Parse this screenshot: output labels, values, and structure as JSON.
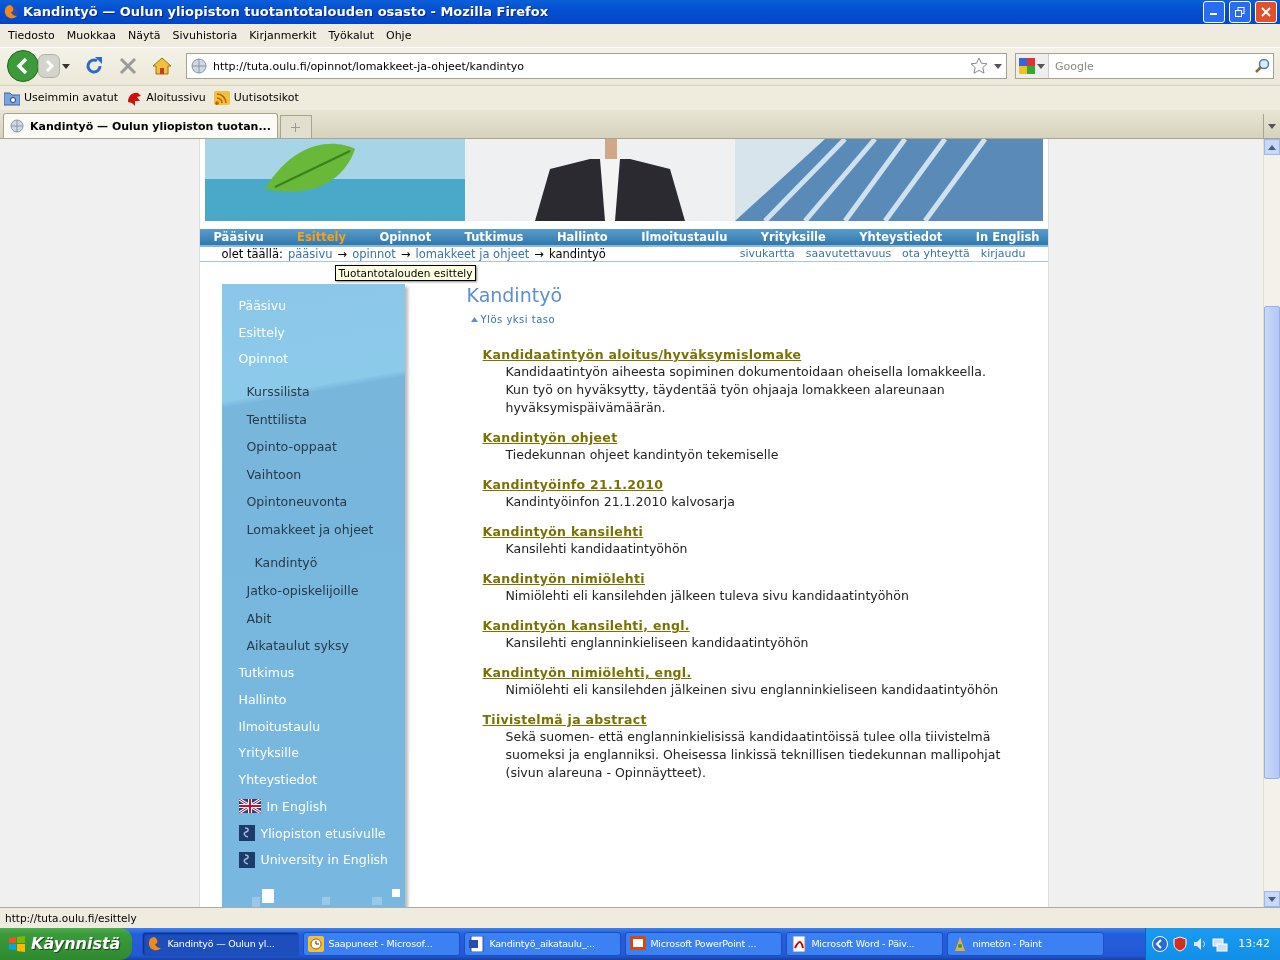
{
  "window": {
    "title": "Kandintyö — Oulun yliopiston tuotantotalouden osasto - Mozilla Firefox"
  },
  "menu": [
    "Tiedosto",
    "Muokkaa",
    "Näytä",
    "Sivuhistoria",
    "Kirjanmerkit",
    "Työkalut",
    "Ohje"
  ],
  "toolbar": {
    "url": "http://tuta.oulu.fi/opinnot/lomakkeet-ja-ohjeet/kandintyo",
    "search": {
      "placeholder": "Google"
    }
  },
  "bookmarks": [
    "Useimmin avatut",
    "Aloitussivu",
    "Uutisotsikot"
  ],
  "tabs": [
    {
      "label": "Kandintyö — Oulun yliopiston tuotan...",
      "selected": true
    }
  ],
  "page": {
    "nav": [
      {
        "label": "Pääsivu",
        "selected": false
      },
      {
        "label": "Esittely",
        "selected": true
      },
      {
        "label": "Opinnot",
        "selected": false
      },
      {
        "label": "Tutkimus",
        "selected": false
      },
      {
        "label": "Hallinto",
        "selected": false
      },
      {
        "label": "Ilmoitustaulu",
        "selected": false
      },
      {
        "label": "Yrityksille",
        "selected": false
      },
      {
        "label": "Yhteystiedot",
        "selected": false
      },
      {
        "label": "In English",
        "selected": false
      }
    ],
    "breadcrumb": {
      "prefix": "olet täällä:",
      "links": [
        "pääsivu",
        "opinnot",
        "lomakkeet ja ohjeet"
      ],
      "separator": "→",
      "current": "kandintyö"
    },
    "utility_links": [
      "sivukartta",
      "saavutettavuus",
      "ota yhteyttä",
      "kirjaudu"
    ],
    "tooltip": "Tuotantotalouden esittely",
    "sidebar": [
      {
        "label": "Pääsivu",
        "kind": "link"
      },
      {
        "label": "Esittely",
        "kind": "link"
      },
      {
        "label": "Opinnot",
        "kind": "link",
        "children": [
          {
            "label": "Kurssilista",
            "kind": "link"
          },
          {
            "label": "Tenttilista",
            "kind": "link"
          },
          {
            "label": "Opinto-oppaat",
            "kind": "link"
          },
          {
            "label": "Vaihtoon",
            "kind": "link"
          },
          {
            "label": "Opintoneuvonta",
            "kind": "link"
          },
          {
            "label": "Lomakkeet ja ohjeet",
            "kind": "link",
            "children": [
              {
                "label": "Kandintyö",
                "kind": "link"
              }
            ]
          },
          {
            "label": "Jatko-opiskelijoille",
            "kind": "link"
          },
          {
            "label": "Abit",
            "kind": "link"
          },
          {
            "label": "Aikataulut syksy",
            "kind": "link"
          }
        ]
      },
      {
        "label": "Tutkimus",
        "kind": "link"
      },
      {
        "label": "Hallinto",
        "kind": "link"
      },
      {
        "label": "Ilmoitustaulu",
        "kind": "link"
      },
      {
        "label": "Yrityksille",
        "kind": "link"
      },
      {
        "label": "Yhteystiedot",
        "kind": "link"
      },
      {
        "label": "In English",
        "kind": "flag"
      },
      {
        "label": "Yliopiston etusivulle",
        "kind": "logo"
      },
      {
        "label": "University in English",
        "kind": "logo"
      }
    ],
    "heading": "Kandintyö",
    "up_link": "Ylös yksi taso",
    "documents": [
      {
        "title": "Kandidaatintyön aloitus/hyväksymislomake",
        "description": "Kandidaatintyön aiheesta sopiminen dokumentoidaan oheisella lomakkeella. Kun työ on hyväksytty, täydentää työn ohjaaja lomakkeen alareunaan hyväksymispäivämäärän."
      },
      {
        "title": "Kandintyön ohjeet",
        "description": "Tiedekunnan ohjeet kandintyön tekemiselle"
      },
      {
        "title": "Kandintyöinfo 21.1.2010",
        "description": "Kandintyöinfon 21.1.2010 kalvosarja"
      },
      {
        "title": "Kandintyön kansilehti",
        "description": "Kansilehti kandidaatintyöhön"
      },
      {
        "title": "Kandintyön nimiölehti",
        "description": "Nimiölehti eli kansilehden jälkeen tuleva sivu kandidaatintyöhön"
      },
      {
        "title": "Kandintyön kansilehti, engl.",
        "description": "Kansilehti englanninkieliseen kandidaatintyöhön"
      },
      {
        "title": "Kandintyön nimiölehti, engl.",
        "description": "Nimiölehti eli kansilehden jälkeinen sivu englanninkieliseen kandidaatintyöhön"
      },
      {
        "title": "Tiivistelmä ja abstract",
        "description": "Sekä suomen- että englanninkielisissä kandidaatintöissä tulee olla tiivistelmä suomeksi ja englanniksi. Oheisessa linkissä teknillisen tiedekunnan mallipohjat (sivun alareuna - Opinnäytteet)."
      }
    ]
  },
  "status_bar": "http://tuta.oulu.fi/esittely",
  "taskbar": {
    "start": "Käynnistä",
    "tasks": [
      {
        "label": "Kandintyö — Oulun yl...",
        "selected": true
      },
      {
        "label": "Saapuneet - Microsof...",
        "selected": false
      },
      {
        "label": "Kandintyö_aikataulu_...",
        "selected": false
      },
      {
        "label": "Microsoft PowerPoint ...",
        "selected": false
      },
      {
        "label": "Microsoft Word - Päiv...",
        "selected": false
      },
      {
        "label": "nimetön - Paint",
        "selected": false
      }
    ],
    "clock": "13:42"
  }
}
